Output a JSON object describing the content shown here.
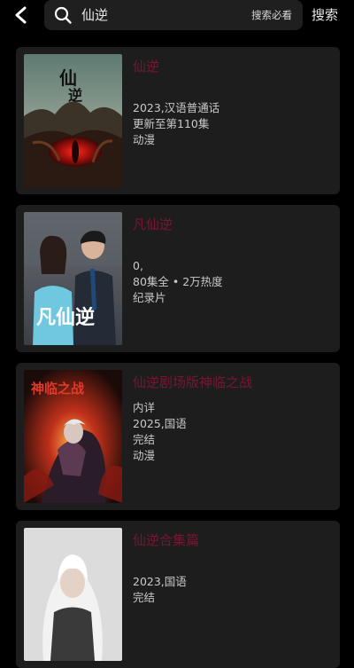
{
  "header": {
    "query": "仙逆",
    "hint": "搜索必看",
    "search_label": "搜索"
  },
  "results": [
    {
      "title": "仙逆",
      "lines": [
        "2023,汉语普通话",
        "更新至第110集",
        "动漫"
      ],
      "poster_icon": "poster-red-eye-dragon",
      "poster_text": "仙逆"
    },
    {
      "title": "凡仙逆",
      "lines": [
        "0,",
        "80集全 • 2万热度",
        "纪录片"
      ],
      "poster_icon": "poster-couple-live-action",
      "poster_text": "凡仙逆"
    },
    {
      "title": "仙逆剧场版神临之战",
      "lines": [
        "内详",
        "2025,国语",
        "完结",
        "动漫"
      ],
      "poster_icon": "poster-battle-flames",
      "poster_text": "神临之战"
    },
    {
      "title": "仙逆合集篇",
      "lines": [
        "2023,国语",
        "完结"
      ],
      "poster_icon": "poster-white-hair-hero",
      "poster_text": ""
    }
  ],
  "colors": {
    "background": "#000000",
    "card": "#1d1d1d",
    "title": "#7b1533",
    "text": "#c9c9c9"
  }
}
